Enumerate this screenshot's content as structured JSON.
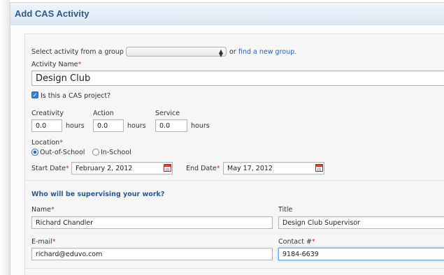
{
  "window": {
    "title": "Add CAS Activity"
  },
  "group_select": {
    "label": "Select activity from a group",
    "selected": "",
    "link_prefix": "or",
    "link_text": "find a new group."
  },
  "activity": {
    "name_label": "Activity Name",
    "name_value": "Design Club",
    "cas_project_label": "Is this a CAS project?",
    "cas_project_checked": true
  },
  "hours": {
    "creativity_label": "Creativity",
    "creativity_value": "0.0",
    "action_label": "Action",
    "action_value": "0.0",
    "service_label": "Service",
    "service_value": "0.0",
    "unit": "hours"
  },
  "location": {
    "label": "Location",
    "options": [
      "Out-of-School",
      "In-School"
    ],
    "selected": "Out-of-School"
  },
  "dates": {
    "start_label": "Start Date",
    "start_value": "February 2, 2012",
    "end_label": "End Date",
    "end_value": "May 17, 2012"
  },
  "supervisor": {
    "heading": "Who will be supervising your work?",
    "name_label": "Name",
    "name_value": "Richard Chandler",
    "title_label": "Title",
    "title_value": "Design Club Supervisor",
    "email_label": "E-mail",
    "email_value": "richard@eduvo.com",
    "contact_label": "Contact #",
    "contact_value": "9184-6639"
  },
  "required_marker": "*",
  "colors": {
    "accent": "#2c5a8c",
    "link": "#2a63a8",
    "required": "#c0392b"
  }
}
